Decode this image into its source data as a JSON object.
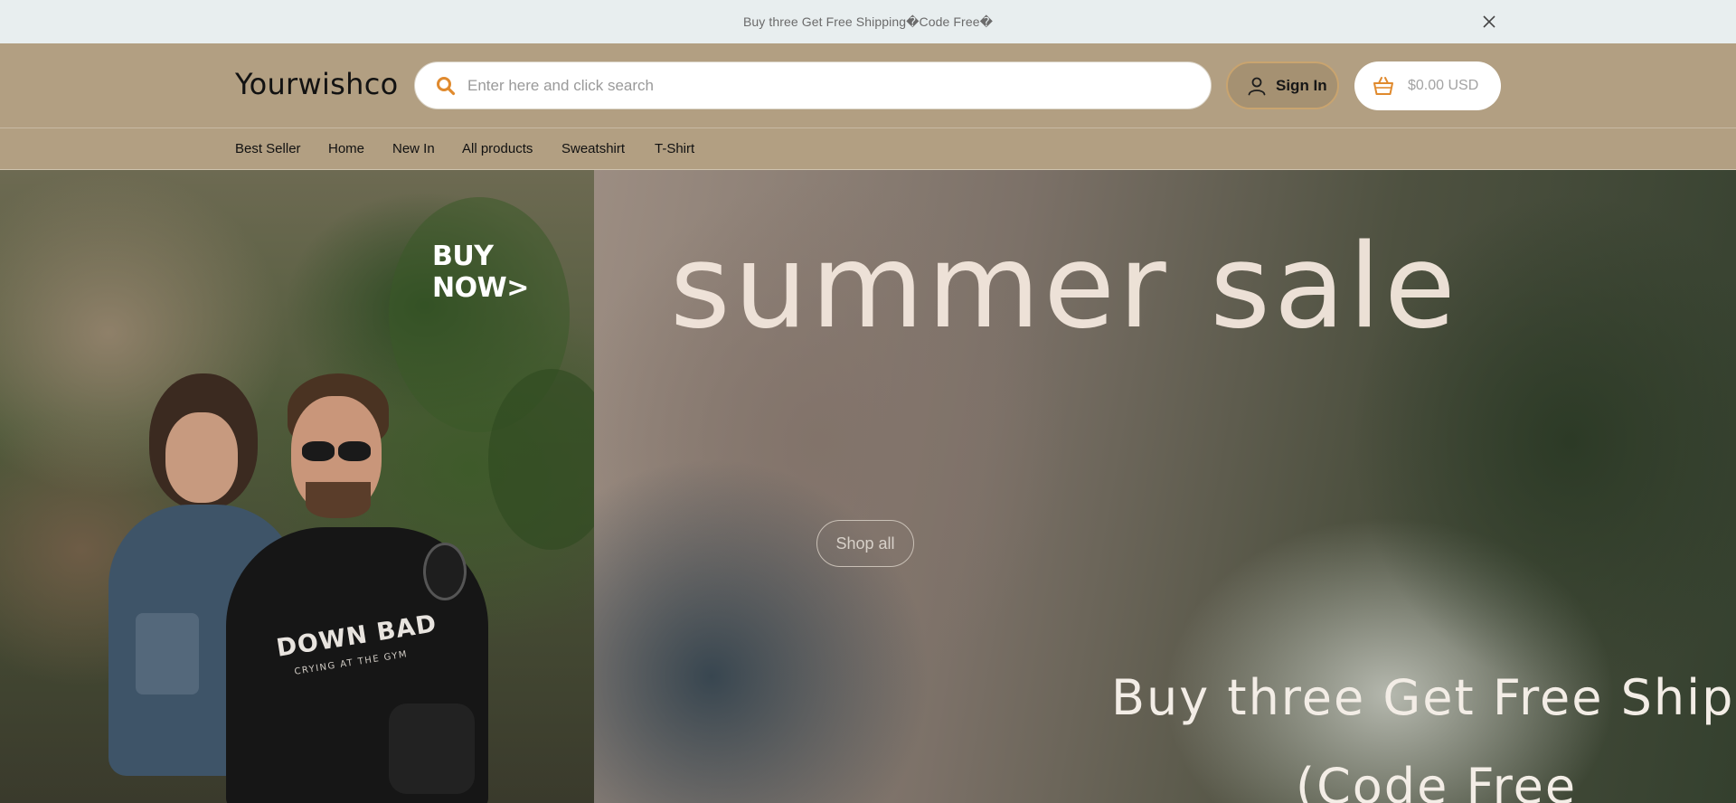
{
  "announcement": {
    "text": "Buy three Get Free Shipping�Code Free�"
  },
  "header": {
    "logo": "Yourwishco",
    "search_placeholder": "Enter here and click search",
    "signin_label": "Sign In",
    "cart_total": "$0.00 USD"
  },
  "nav": {
    "items": [
      {
        "label": "Best Seller"
      },
      {
        "label": "Home"
      },
      {
        "label": "New In"
      },
      {
        "label": "All products"
      },
      {
        "label": "Sweatshirt"
      },
      {
        "label": "T-Shirt"
      }
    ]
  },
  "hero": {
    "buy_now": "BUY NOW>",
    "headline": "summer sale",
    "shop_all": "Shop all",
    "promo_line1": "Buy three Get Free Shipping",
    "promo_line2": "(Code Free",
    "tshirt_print": "DOWN BAD",
    "tshirt_subprint": "CRYING AT THE GYM"
  },
  "icons": {
    "close": "close-icon",
    "search": "search-icon",
    "user": "user-icon",
    "cart": "basket-icon"
  },
  "colors": {
    "announcement_bg": "#e8eeef",
    "header_bg": "#b29f82",
    "search_icon": "#e08a2e",
    "signin_border": "#c9a46f"
  }
}
